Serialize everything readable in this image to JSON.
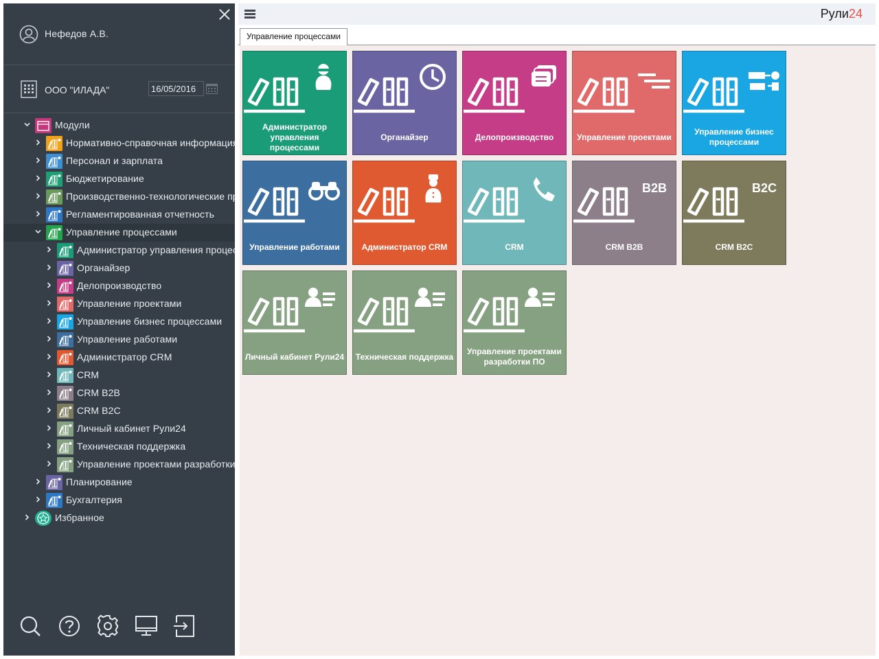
{
  "user": {
    "name": "Нефедов А.В."
  },
  "org": {
    "name": "ООО \"ИЛАДА\"",
    "date": "16/05/2016"
  },
  "tree": [
    {
      "label": "Модули",
      "level": 0,
      "color": "#c0397c",
      "expanded": true
    },
    {
      "label": "Нормативно-справочная информация",
      "level": 1,
      "color": "#f0a21b"
    },
    {
      "label": "Персонал и зарплата",
      "level": 1,
      "color": "#3f8fd0"
    },
    {
      "label": "Бюджетирование",
      "level": 1,
      "color": "#1e9f76"
    },
    {
      "label": "Производственно-технологические процессы",
      "level": 1,
      "color": "#6b9a5c"
    },
    {
      "label": "Регламентированная отчетность",
      "level": 1,
      "color": "#2e77c4"
    },
    {
      "label": "Управление процессами",
      "level": 1,
      "color": "#24a24d",
      "expanded": true,
      "selected": true
    },
    {
      "label": "Администратор управления процессами",
      "level": 2,
      "color": "#1a9c78"
    },
    {
      "label": "Органайзер",
      "level": 2,
      "color": "#6a64a2"
    },
    {
      "label": "Делопроизводство",
      "level": 2,
      "color": "#c43d86"
    },
    {
      "label": "Управление проектами",
      "level": 2,
      "color": "#e06a6a"
    },
    {
      "label": "Управление бизнес процессами",
      "level": 2,
      "color": "#1aa6e2"
    },
    {
      "label": "Управление работами",
      "level": 2,
      "color": "#3c6f9f"
    },
    {
      "label": "Администратор CRM",
      "level": 2,
      "color": "#e05a31"
    },
    {
      "label": "CRM",
      "level": 2,
      "color": "#6fb7b9"
    },
    {
      "label": "CRM B2B",
      "level": 2,
      "color": "#8c7f8a"
    },
    {
      "label": "CRM B2C",
      "level": 2,
      "color": "#7d7b5c"
    },
    {
      "label": "Личный кабинет Рули24",
      "level": 2,
      "color": "#86a181"
    },
    {
      "label": "Техническая поддержка",
      "level": 2,
      "color": "#86a181"
    },
    {
      "label": "Управление проектами разработки ПО",
      "level": 2,
      "color": "#86a181"
    },
    {
      "label": "Планирование",
      "level": 1,
      "color": "#6a64a2"
    },
    {
      "label": "Бухгалтерия",
      "level": 1,
      "color": "#2e77c4"
    },
    {
      "label": "Избранное",
      "level": 0,
      "color": "#1fb08f",
      "favorite": true
    }
  ],
  "bottom_icons": [
    "search-icon",
    "help-icon",
    "settings-icon",
    "monitor-icon",
    "logout-icon"
  ],
  "header": {
    "brand_text": "Рули",
    "brand_accent": "24",
    "brand_accent_color": "#e2514a"
  },
  "tab": {
    "label": "Управление процессами"
  },
  "tiles": [
    {
      "label": "Администратор управления процессами",
      "color": "#1a9c78",
      "icon": "admin-person-icon"
    },
    {
      "label": "Органайзер",
      "color": "#6a64a2",
      "icon": "clock-icon"
    },
    {
      "label": "Делопроизводство",
      "color": "#c43d86",
      "icon": "documents-icon"
    },
    {
      "label": "Управление проектами",
      "color": "#e06a6a",
      "icon": "gantt-icon"
    },
    {
      "label": "Управление бизнес процессами",
      "color": "#1aa6e2",
      "icon": "flowchart-icon"
    },
    {
      "label": "Управление работами",
      "color": "#3c6f9f",
      "icon": "binoculars-icon"
    },
    {
      "label": "Администратор CRM",
      "color": "#e05a31",
      "icon": "crm-admin-person-icon"
    },
    {
      "label": "CRM",
      "color": "#6fb7b9",
      "icon": "phone-icon"
    },
    {
      "label": "CRM B2B",
      "color": "#8c7f8a",
      "icon": "b2b-icon",
      "badge": "B2B"
    },
    {
      "label": "CRM B2C",
      "color": "#7d7b5c",
      "icon": "b2c-icon",
      "badge": "B2C"
    },
    {
      "label": "Личный кабинет Рули24",
      "color": "#86a181",
      "icon": "user-card-icon"
    },
    {
      "label": "Техническая поддержка",
      "color": "#86a181",
      "icon": "user-card-icon"
    },
    {
      "label": "Управление проектами разработки ПО",
      "color": "#86a181",
      "icon": "user-card-icon"
    }
  ]
}
